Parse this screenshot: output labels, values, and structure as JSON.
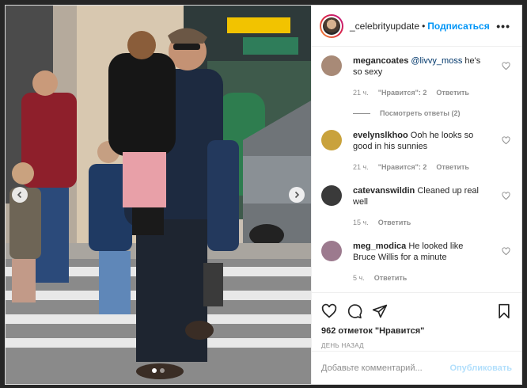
{
  "header": {
    "username": "_celebrityupdate",
    "separator": "•",
    "follow_label": "Подписаться",
    "more_icon": "more-options-icon"
  },
  "comments": [
    {
      "username": "megancoates",
      "mention": "@livvy_moss",
      "text": " he's so sexy",
      "time": "21 ч.",
      "likes": "\"Нравится\": 2",
      "reply": "Ответить",
      "view_replies": "Посмотреть ответы (2)",
      "avatar_color": "#a88a77"
    },
    {
      "username": "evelynslkhoo",
      "mention": "",
      "text": "Ooh he looks so good in his sunnies",
      "time": "21 ч.",
      "likes": "\"Нравится\": 2",
      "reply": "Ответить",
      "avatar_color": "#c9a23c"
    },
    {
      "username": "catevanswildin",
      "mention": "",
      "text": "Cleaned up real well",
      "time": "15 ч.",
      "reply": "Ответить",
      "avatar_color": "#3a3a3a"
    },
    {
      "username": "meg_modica",
      "mention": "",
      "text": "He looked like Bruce Willis for a minute",
      "time": "5 ч.",
      "reply": "Ответить",
      "avatar_color": "#9c7a8e"
    }
  ],
  "actions": {
    "likes_count": "962 отметок \"Нравится\"",
    "date": "ДЕНЬ НАЗАД"
  },
  "composer": {
    "placeholder": "Добавьте комментарий...",
    "post_label": "Опубликовать"
  },
  "carousel": {
    "current_index": 1,
    "total": 2
  },
  "colors": {
    "accent": "#0095f6",
    "post_disabled": "#b2dffc",
    "meta_gray": "#8e8e8e"
  }
}
